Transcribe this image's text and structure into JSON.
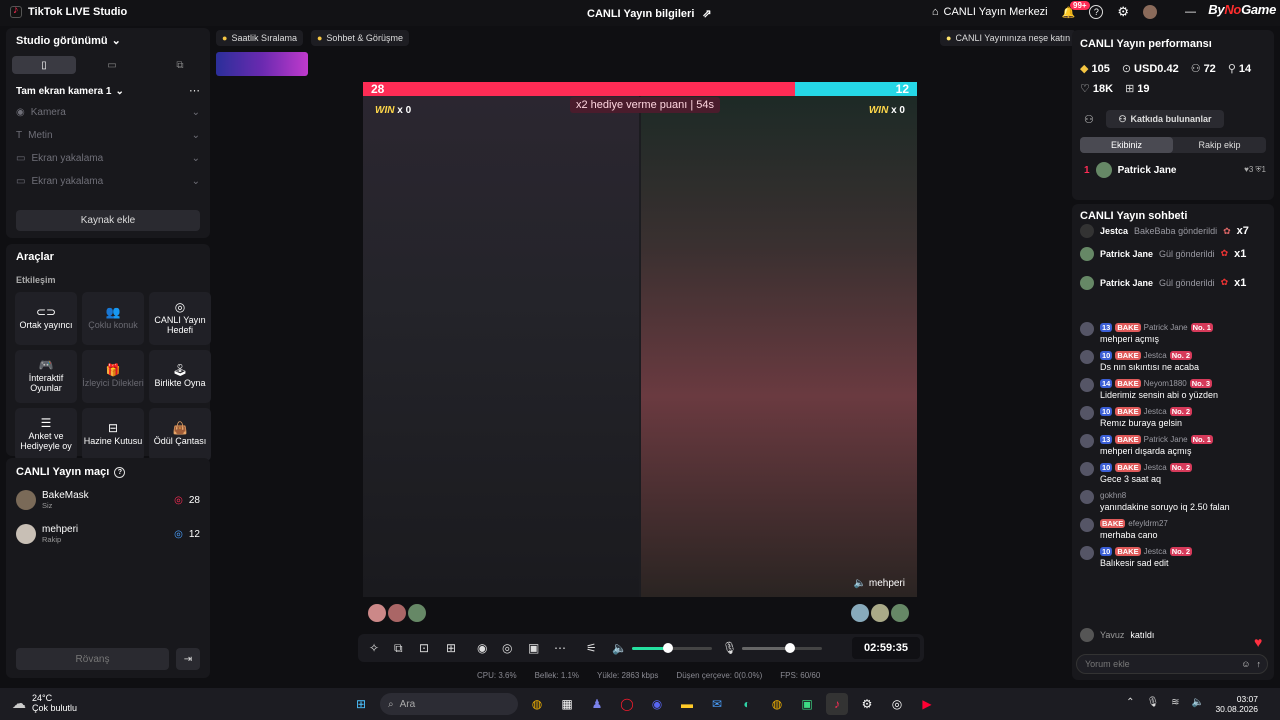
{
  "titlebar": {
    "app_name": "TikTok LIVE Studio",
    "center_title": "CANLI Yayın bilgileri",
    "live_center": "CANLI Yayın Merkezi",
    "notif_count": "99+",
    "brand_pre": "By",
    "brand_accent": "No",
    "brand_post": "Game"
  },
  "top_chips": {
    "hourly_ranking": "Saatlik Sıralama",
    "chat_meeting": "Sohbet & Görüşme",
    "tip": "CANLI Yayınınıza neşe katın"
  },
  "left": {
    "studio_view": "Studio görünümü",
    "scene_name": "Tam ekran kamera 1",
    "sources": [
      "Kamera",
      "Metin",
      "Ekran yakalama",
      "Ekran yakalama"
    ],
    "add_source": "Kaynak ekle",
    "tools_title": "Araçlar",
    "interaction_label": "Etkileşim",
    "tools": [
      {
        "label": "Ortak yayıncı",
        "dim": false
      },
      {
        "label": "Çoklu konuk",
        "dim": true
      },
      {
        "label": "CANLI Yayın Hedefi",
        "dim": false
      },
      {
        "label": "İnteraktif Oyunlar",
        "dim": false
      },
      {
        "label": "İzleyici Dilekleri",
        "dim": true
      },
      {
        "label": "Birlikte Oyna",
        "dim": false
      },
      {
        "label": "Anket ve Hediyeyle oy",
        "dim": false
      },
      {
        "label": "Hazine Kutusu",
        "dim": false
      },
      {
        "label": "Ödül Çantası",
        "dim": false
      }
    ],
    "match_title": "CANLI Yayın maçı",
    "match": [
      {
        "name": "BakeMask",
        "role": "Siz",
        "score": "28"
      },
      {
        "name": "mehperi",
        "role": "Rakip",
        "score": "12"
      }
    ],
    "rematch": "Rövanş"
  },
  "battle": {
    "score_left": "28",
    "score_right": "12",
    "score_left_value": 28,
    "score_right_value": 12,
    "multiplier_text": "x2 hediye verme puanı",
    "countdown": "54s",
    "win_label": "WIN",
    "win_left": "x 0",
    "win_right": "x 0",
    "right_name": "mehperi"
  },
  "controls": {
    "timer": "02:59:35",
    "volume_level": 0.45,
    "mic_level": 0.6
  },
  "stats": {
    "cpu": "CPU: 3.6%",
    "memory": "Bellek: 1.1%",
    "upload": "Yükle: 2863 kbps",
    "dropped": "Düşen çerçeve: 0(0.0%)",
    "fps": "FPS: 60/60"
  },
  "right": {
    "perf_title": "CANLI Yayın performansı",
    "perf": {
      "coins": "105",
      "usd": "USD0.42",
      "viewers": "72",
      "new": "14",
      "likes": "18K",
      "gifts": "19"
    },
    "contributors": "Katkıda bulunanlar",
    "tab_team": "Ekibiniz",
    "tab_rival": "Rakip ekip",
    "leader_rank": "1",
    "leader_name": "Patrick Jane",
    "leader_stats": "♥3  ⛨1",
    "chat_title": "CANLI Yayın sohbeti",
    "gifts": [
      {
        "user": "Jestca",
        "action": "BakeBaba gönderildi",
        "count": "x7"
      },
      {
        "user": "Patrick Jane",
        "action": "Gül gönderildi",
        "count": "x1"
      },
      {
        "user": "Patrick Jane",
        "action": "Gül gönderildi",
        "count": "x1"
      }
    ],
    "messages": [
      {
        "lvl": "13",
        "fan": "BAKE",
        "user": "Patrick Jane",
        "rank": "No. 1",
        "text": "mehperi açmış"
      },
      {
        "lvl": "10",
        "fan": "BAKE",
        "user": "Jestca",
        "rank": "No. 2",
        "text": "Ds nın sıkıntısı ne acaba"
      },
      {
        "lvl": "14",
        "fan": "BAKE",
        "user": "Neyom1880",
        "rank": "No. 3",
        "text": "Liderimiz sensin abi o yüzden"
      },
      {
        "lvl": "10",
        "fan": "BAKE",
        "user": "Jestca",
        "rank": "No. 2",
        "text": "Remız buraya gelsin"
      },
      {
        "lvl": "13",
        "fan": "BAKE",
        "user": "Patrick Jane",
        "rank": "No. 1",
        "text": "mehperi dışarda açmış"
      },
      {
        "lvl": "10",
        "fan": "BAKE",
        "user": "Jestca",
        "rank": "No. 2",
        "text": "Gece 3 saat aq"
      },
      {
        "lvl": "",
        "fan": "",
        "user": "gokhn8",
        "rank": "",
        "text": "yanındakine soruyo iq 2.50 falan"
      },
      {
        "lvl": "",
        "fan": "BAKE",
        "user": "efeyldrm27",
        "rank": "",
        "text": "merhaba cano"
      },
      {
        "lvl": "10",
        "fan": "BAKE",
        "user": "Jestca",
        "rank": "No. 2",
        "text": "Balıkesir sad edit"
      }
    ],
    "joined_user": "Yavuz",
    "joined_text": "katıldı",
    "comment_placeholder": "Yorum ekle"
  },
  "taskbar": {
    "temp": "24°C",
    "weather": "Çok bulutlu",
    "search": "Ara",
    "time": "03:07",
    "date": "30.08.2026"
  },
  "colors": {
    "pink": "#fe2c55",
    "cyan": "#25d7e6",
    "accent_green": "#25e0a0"
  }
}
